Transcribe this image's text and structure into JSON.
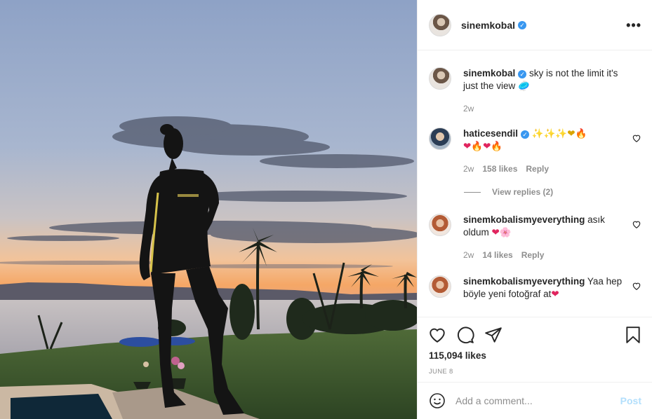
{
  "post": {
    "author": "sinemkobal",
    "caption_text": "sky is not the limit it's just the view",
    "caption_emoji": "🥏",
    "caption_time": "2w",
    "likes": "115,094 likes",
    "date": "JUNE 8"
  },
  "comments": [
    {
      "user": "haticesendil",
      "verified": true,
      "text_emoji_line1": "✨✨✨❤🔥",
      "text_emoji_line2": "❤🔥❤🔥",
      "time": "2w",
      "likes": "158 likes",
      "reply_label": "Reply",
      "view_replies": "View replies (2)"
    },
    {
      "user": "sinemkobalismyeverything",
      "text": "asık oldum",
      "text_emoji": "❤🌸",
      "time": "2w",
      "likes": "14 likes",
      "reply_label": "Reply"
    },
    {
      "user": "sinemkobalismyeverything",
      "text": "Yaa hep böyle yeni fotoğraf at",
      "text_emoji": "❤"
    }
  ],
  "composer": {
    "placeholder": "Add a comment...",
    "post_label": "Post"
  },
  "colors": {
    "verified": "#3897f0",
    "link_disabled": "#b2dffc",
    "muted": "#8e8e8e"
  },
  "icons": {
    "header_more": "more-horizontal-icon",
    "like": "heart-outline-icon",
    "comment": "comment-bubble-icon",
    "share": "paper-plane-icon",
    "save": "bookmark-icon",
    "emoji": "smiley-icon"
  }
}
